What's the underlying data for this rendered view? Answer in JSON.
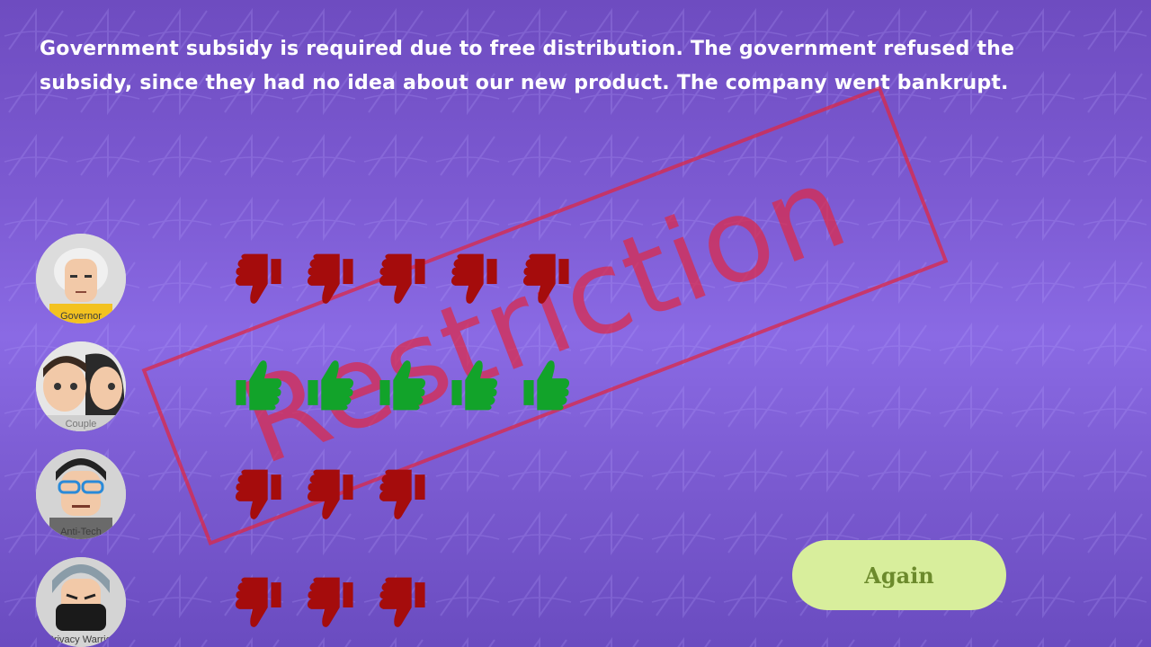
{
  "message": "Government subsidy is required due to free distribution. The government refused the subsidy, since they had no idea about our new product. The company went bankrupt.",
  "stamp": {
    "text": "Restriction",
    "color": "#dc2846"
  },
  "stakeholders": [
    {
      "label": "Governor",
      "vote": "dislike",
      "count": 5,
      "icon": "governor-avatar"
    },
    {
      "label": "Couple",
      "vote": "like",
      "count": 5,
      "icon": "couple-avatar"
    },
    {
      "label": "Anti-Tech",
      "vote": "dislike",
      "count": 3,
      "icon": "anti-tech-avatar"
    },
    {
      "label": "Privacy Warrior",
      "vote": "dislike",
      "count": 3,
      "icon": "privacy-warrior-avatar"
    }
  ],
  "vote_colors": {
    "like": "#12a32a",
    "dislike": "#a50c0c"
  },
  "again_button": {
    "label": "Again",
    "background": "#d8ee9c",
    "color": "#6c8a2c"
  }
}
